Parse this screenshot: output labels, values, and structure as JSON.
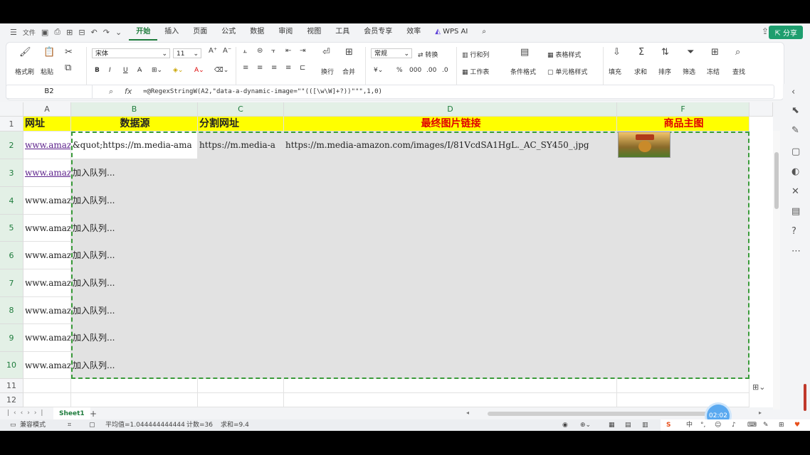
{
  "menu": {
    "file": "文件",
    "tabs": [
      "开始",
      "插入",
      "页面",
      "公式",
      "数据",
      "审阅",
      "视图",
      "工具",
      "会员专享",
      "效率"
    ],
    "active_tab": "开始",
    "wps_ai": "WPS AI",
    "share": "分享"
  },
  "ribbon": {
    "format_painter": "格式刷",
    "paste": "粘贴",
    "font_name": "宋体",
    "font_size": "11",
    "bold": "B",
    "italic": "I",
    "underline": "U",
    "number_format": "常规",
    "convert": "转换",
    "wrap": "换行",
    "merge": "合并",
    "rows_cols": "行和列",
    "worksheet": "工作表",
    "cond_format": "条件格式",
    "table_style": "表格样式",
    "cell_style": "单元格样式",
    "fill": "填充",
    "sum": "求和",
    "sort": "排序",
    "filter": "筛选",
    "freeze": "冻结",
    "find": "查找"
  },
  "formula_bar": {
    "name_box": "B2",
    "fx": "fx",
    "formula": "=@RegexStringW(A2,\"data-a-dynamic-image=\"\"(([\\w\\W]+?))\"\"\",1,0)"
  },
  "columns": [
    "A",
    "B",
    "C",
    "D",
    "F"
  ],
  "rows": [
    "1",
    "2",
    "3",
    "4",
    "5",
    "6",
    "7",
    "8",
    "9",
    "10",
    "11",
    "12"
  ],
  "headers": {
    "a": "网址",
    "b": "数据源",
    "c": "分割网址",
    "d": "最终图片链接",
    "f": "商品主图"
  },
  "row2": {
    "a": "www.amazo",
    "b": "&quot;https://m.media-ama",
    "c": "https://m.media-a",
    "d": "https://m.media-amazon.com/images/I/81VcdSA1HgL._AC_SY450_.jpg"
  },
  "data_rows": [
    {
      "a": "www.amazo",
      "b": "加入队列..."
    },
    {
      "a": "www.amazo",
      "b": "加入队列..."
    },
    {
      "a": "www.amazo",
      "b": "加入队列..."
    },
    {
      "a": "www.amazo",
      "b": "加入队列..."
    },
    {
      "a": "www.amazo",
      "b": "加入队列..."
    },
    {
      "a": "www.amazo",
      "b": "加入队列..."
    },
    {
      "a": "www.amazo",
      "b": "加入队列..."
    },
    {
      "a": "www.amazo",
      "b": "加入队列..."
    }
  ],
  "sheet_tab": "Sheet1",
  "status": {
    "compat": "兼容模式",
    "average": "平均值=1.044444444444",
    "count": "计数=36",
    "sum": "求和=9.4"
  },
  "timer": "02:02",
  "ime": "中",
  "colors": {
    "accent": "#1e7c3c",
    "header_fill": "#ffff00",
    "header_red": "#e00000",
    "selection": "#3a9b3a"
  }
}
